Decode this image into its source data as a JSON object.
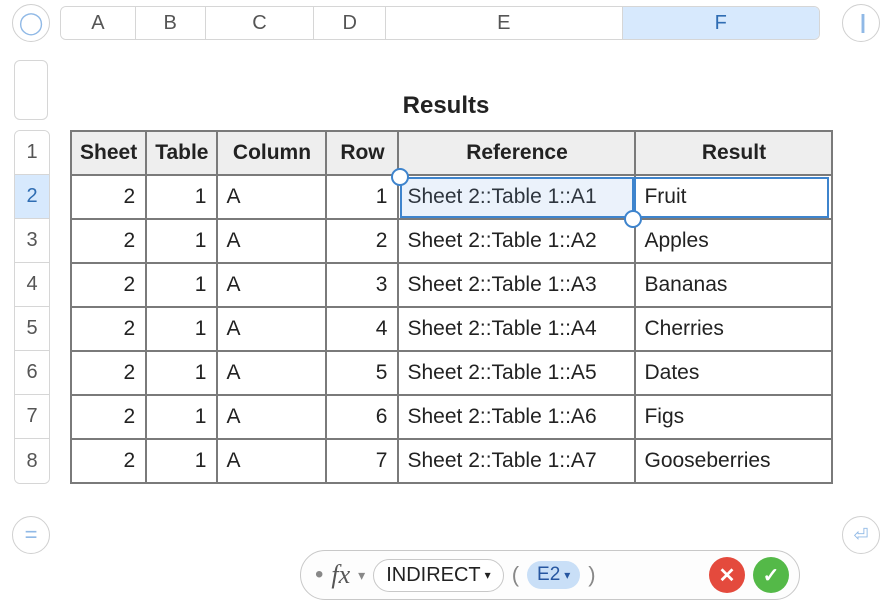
{
  "columns": [
    "A",
    "B",
    "C",
    "D",
    "E",
    "F"
  ],
  "selected_column": "F",
  "row_numbers": [
    1,
    2,
    3,
    4,
    5,
    6,
    7,
    8
  ],
  "selected_row": 2,
  "title": "Results",
  "headers": {
    "A": "Sheet",
    "B": "Table",
    "C": "Column",
    "D": "Row",
    "E": "Reference",
    "F": "Result"
  },
  "rows": [
    {
      "sheet": "2",
      "table": "1",
      "col": "A",
      "row": "1",
      "ref": "Sheet 2::Table 1::A1",
      "res": "Fruit"
    },
    {
      "sheet": "2",
      "table": "1",
      "col": "A",
      "row": "2",
      "ref": "Sheet 2::Table 1::A2",
      "res": "Apples"
    },
    {
      "sheet": "2",
      "table": "1",
      "col": "A",
      "row": "3",
      "ref": "Sheet 2::Table 1::A3",
      "res": "Bananas"
    },
    {
      "sheet": "2",
      "table": "1",
      "col": "A",
      "row": "4",
      "ref": "Sheet 2::Table 1::A4",
      "res": "Cherries"
    },
    {
      "sheet": "2",
      "table": "1",
      "col": "A",
      "row": "5",
      "ref": "Sheet 2::Table 1::A5",
      "res": "Dates"
    },
    {
      "sheet": "2",
      "table": "1",
      "col": "A",
      "row": "6",
      "ref": "Sheet 2::Table 1::A6",
      "res": "Figs"
    },
    {
      "sheet": "2",
      "table": "1",
      "col": "A",
      "row": "7",
      "ref": "Sheet 2::Table 1::A7",
      "res": "Gooseberries"
    }
  ],
  "formula": {
    "fx_label": "fx",
    "fn_name": "INDIRECT",
    "arg": "E2"
  },
  "icons": {
    "circle": "◯",
    "pause": "||",
    "equals": "=",
    "return": "⏎",
    "dropdown": "▾",
    "cancel": "✕",
    "confirm": "✓",
    "dot": "•"
  }
}
